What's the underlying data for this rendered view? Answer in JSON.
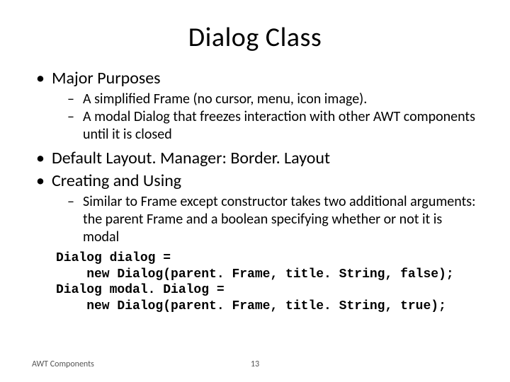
{
  "title": "Dialog Class",
  "bullets": {
    "b1": "Major Purposes",
    "b1_1": "A simplified Frame (no cursor, menu, icon image).",
    "b1_2": "A modal Dialog that freezes interaction with other AWT components until it is closed",
    "b2": "Default Layout. Manager: Border. Layout",
    "b3": "Creating and Using",
    "b3_1": "Similar to Frame except constructor takes two additional arguments: the parent Frame and a boolean specifying whether or not it is modal"
  },
  "code": "Dialog dialog =\n    new Dialog(parent. Frame, title. String, false);\nDialog modal. Dialog =\n    new Dialog(parent. Frame, title. String, true);",
  "footer": {
    "left": "AWT Components",
    "page": "13"
  }
}
